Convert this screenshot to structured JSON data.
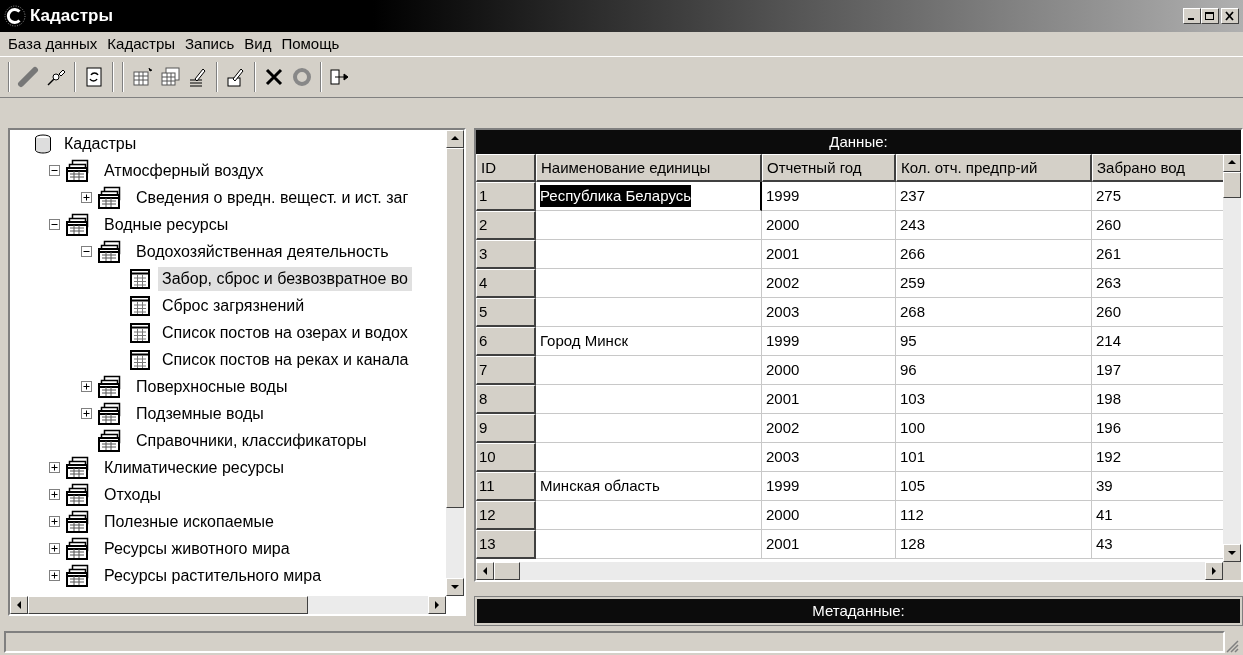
{
  "window": {
    "title": "Кадастры"
  },
  "menu": [
    "База данных",
    "Кадастры",
    "Запись",
    "Вид",
    "Помощь"
  ],
  "tree": {
    "label": "Кадастры",
    "kind": "root",
    "selected": false,
    "children": [
      {
        "label": "Атмосферный воздух",
        "kind": "folder",
        "expanded": true,
        "selected": false,
        "children": [
          {
            "label": "Сведения о вредн. вещест. и ист. заг",
            "kind": "folder",
            "expanded": false,
            "selected": false
          }
        ]
      },
      {
        "label": "Водные ресурсы",
        "kind": "folder",
        "expanded": true,
        "selected": false,
        "children": [
          {
            "label": "Водохозяйственная деятельность",
            "kind": "folder",
            "expanded": true,
            "selected": false,
            "children": [
              {
                "label": "Забор, сброс и безвозвратное во",
                "kind": "table",
                "selected": true
              },
              {
                "label": "Сброс загрязнений",
                "kind": "table",
                "selected": false
              },
              {
                "label": "Список постов на озерах и водох",
                "kind": "table",
                "selected": false
              },
              {
                "label": "Список постов на реках и канала",
                "kind": "table",
                "selected": false
              }
            ]
          },
          {
            "label": "Поверхносные воды",
            "kind": "folder",
            "expanded": false,
            "selected": false
          },
          {
            "label": "Подземные воды",
            "kind": "folder",
            "expanded": false,
            "selected": false
          },
          {
            "label": "Справочники, классификаторы",
            "kind": "folder",
            "selected": false
          }
        ]
      },
      {
        "label": "Климатические ресурсы",
        "kind": "folder",
        "expanded": false,
        "selected": false
      },
      {
        "label": "Отходы",
        "kind": "folder",
        "expanded": false,
        "selected": false
      },
      {
        "label": "Полезные ископаемые",
        "kind": "folder",
        "expanded": false,
        "selected": false
      },
      {
        "label": "Ресурсы животного мира",
        "kind": "folder",
        "expanded": false,
        "selected": false
      },
      {
        "label": "Ресурсы растительного мира",
        "kind": "folder",
        "expanded": false,
        "selected": false
      }
    ]
  },
  "data_panel": {
    "title": "Данные:",
    "columns": [
      "ID",
      "Наименование единицы",
      "Отчетный год",
      "Кол. отч. предпр-ий",
      "Забрано вод"
    ],
    "rows": [
      {
        "id": "1",
        "name": "Республика Беларусь",
        "name_selected": true,
        "year": "1999",
        "count": "237",
        "water": "275"
      },
      {
        "id": "2",
        "name_selected": false,
        "year": "2000",
        "count": "243",
        "water": "260"
      },
      {
        "id": "3",
        "name_selected": false,
        "year": "2001",
        "count": "266",
        "water": "261"
      },
      {
        "id": "4",
        "name_selected": false,
        "year": "2002",
        "count": "259",
        "water": "263"
      },
      {
        "id": "5",
        "name_selected": false,
        "year": "2003",
        "count": "268",
        "water": "260"
      },
      {
        "id": "6",
        "name": "Город Минск",
        "name_selected": false,
        "year": "1999",
        "count": "95",
        "water": "214"
      },
      {
        "id": "7",
        "name_selected": false,
        "year": "2000",
        "count": "96",
        "water": "197"
      },
      {
        "id": "8",
        "name_selected": false,
        "year": "2001",
        "count": "103",
        "water": "198"
      },
      {
        "id": "9",
        "name_selected": false,
        "year": "2002",
        "count": "100",
        "water": "196"
      },
      {
        "id": "10",
        "name_selected": false,
        "year": "2003",
        "count": "101",
        "water": "192"
      },
      {
        "id": "11",
        "name": "Минская область",
        "name_selected": false,
        "year": "1999",
        "count": "105",
        "water": "39"
      },
      {
        "id": "12",
        "name_selected": false,
        "year": "2000",
        "count": "112",
        "water": "41"
      },
      {
        "id": "13",
        "name_selected": false,
        "year": "2001",
        "count": "128",
        "water": "43"
      }
    ]
  },
  "metadata_panel": {
    "title": "Метаданные:"
  }
}
